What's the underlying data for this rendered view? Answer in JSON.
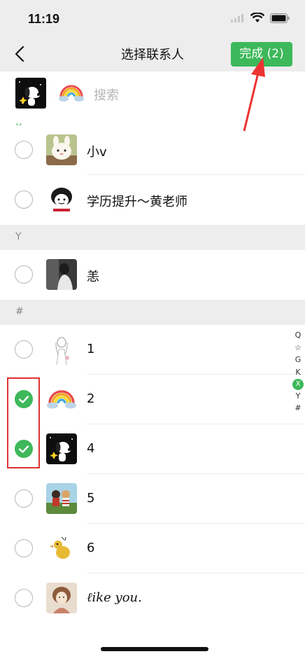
{
  "status": {
    "time": "11:19"
  },
  "nav": {
    "title": "选择联系人",
    "done_label": "完成 (2)"
  },
  "search": {
    "placeholder": "搜索"
  },
  "sections": [
    {
      "letter": "X",
      "contacts": [
        {
          "name": "小v",
          "checked": false,
          "avatar_icon": "bunny-avatar"
        },
        {
          "name": "学历提升～黄老师",
          "checked": false,
          "avatar_icon": "cartoon-avatar"
        }
      ]
    },
    {
      "letter": "Y",
      "contacts": [
        {
          "name": "恙",
          "checked": false,
          "avatar_icon": "photo-avatar"
        }
      ]
    },
    {
      "letter": "#",
      "contacts": [
        {
          "name": "1",
          "checked": false,
          "avatar_icon": "sketch-avatar"
        },
        {
          "name": "2",
          "checked": true,
          "avatar_icon": "rainbow-avatar"
        },
        {
          "name": "4",
          "checked": true,
          "avatar_icon": "snoopy-avatar"
        },
        {
          "name": "5",
          "checked": false,
          "avatar_icon": "couple-avatar"
        },
        {
          "name": "6",
          "checked": false,
          "avatar_icon": "duck-avatar"
        },
        {
          "name": "ℓike you.",
          "checked": false,
          "avatar_icon": "girl-avatar"
        }
      ]
    }
  ],
  "index_bar": [
    "Q",
    "☆",
    "G",
    "K",
    "X",
    "Y",
    "#"
  ],
  "index_active": "X",
  "colors": {
    "accent": "#3db85a",
    "annotation": "#dd3333",
    "background": "#ededed"
  }
}
